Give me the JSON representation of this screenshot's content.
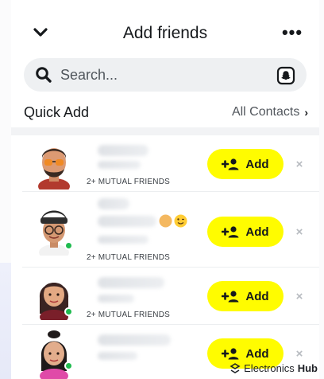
{
  "header": {
    "title": "Add friends",
    "back_icon": "chevron-down-icon",
    "more_label": "•••"
  },
  "search": {
    "placeholder": "Search...",
    "icon": "search-icon",
    "trailing_icon": "snapchat-ghost-icon"
  },
  "section": {
    "title": "Quick Add",
    "link_label": "All Contacts",
    "link_arrow": "›"
  },
  "friends": [
    {
      "mutual": "2+ MUTUAL FRIENDS",
      "add_label": "Add",
      "presence": false,
      "emoji": false
    },
    {
      "mutual": "2+ MUTUAL FRIENDS",
      "add_label": "Add",
      "presence": true,
      "emoji": true
    },
    {
      "mutual": "2+ MUTUAL FRIENDS",
      "add_label": "Add",
      "presence": true,
      "emoji": false
    },
    {
      "mutual": "",
      "add_label": "Add",
      "presence": true,
      "emoji": false
    }
  ],
  "dismiss_label": "×",
  "watermark": {
    "prefix": "Electronics",
    "brand": "Hub"
  },
  "colors": {
    "accent_yellow": "#FFFC00",
    "online_green": "#1FBB4F",
    "search_bg": "#EEF0F2"
  }
}
